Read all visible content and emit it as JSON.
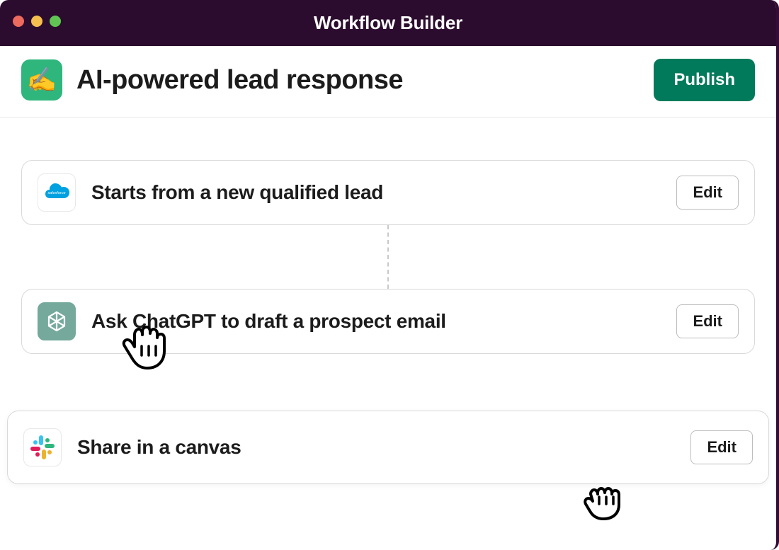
{
  "titlebar": {
    "title": "Workflow Builder"
  },
  "header": {
    "workflow_icon_emoji": "✍️",
    "workflow_title": "AI-powered lead response",
    "publish_label": "Publish"
  },
  "steps": [
    {
      "icon": "salesforce",
      "label": "Starts from a new qualified lead",
      "edit": "Edit"
    },
    {
      "icon": "openai",
      "label": "Ask ChatGPT to draft a prospect email",
      "edit": "Edit"
    },
    {
      "icon": "slack",
      "label": "Share in a canvas",
      "edit": "Edit"
    }
  ]
}
